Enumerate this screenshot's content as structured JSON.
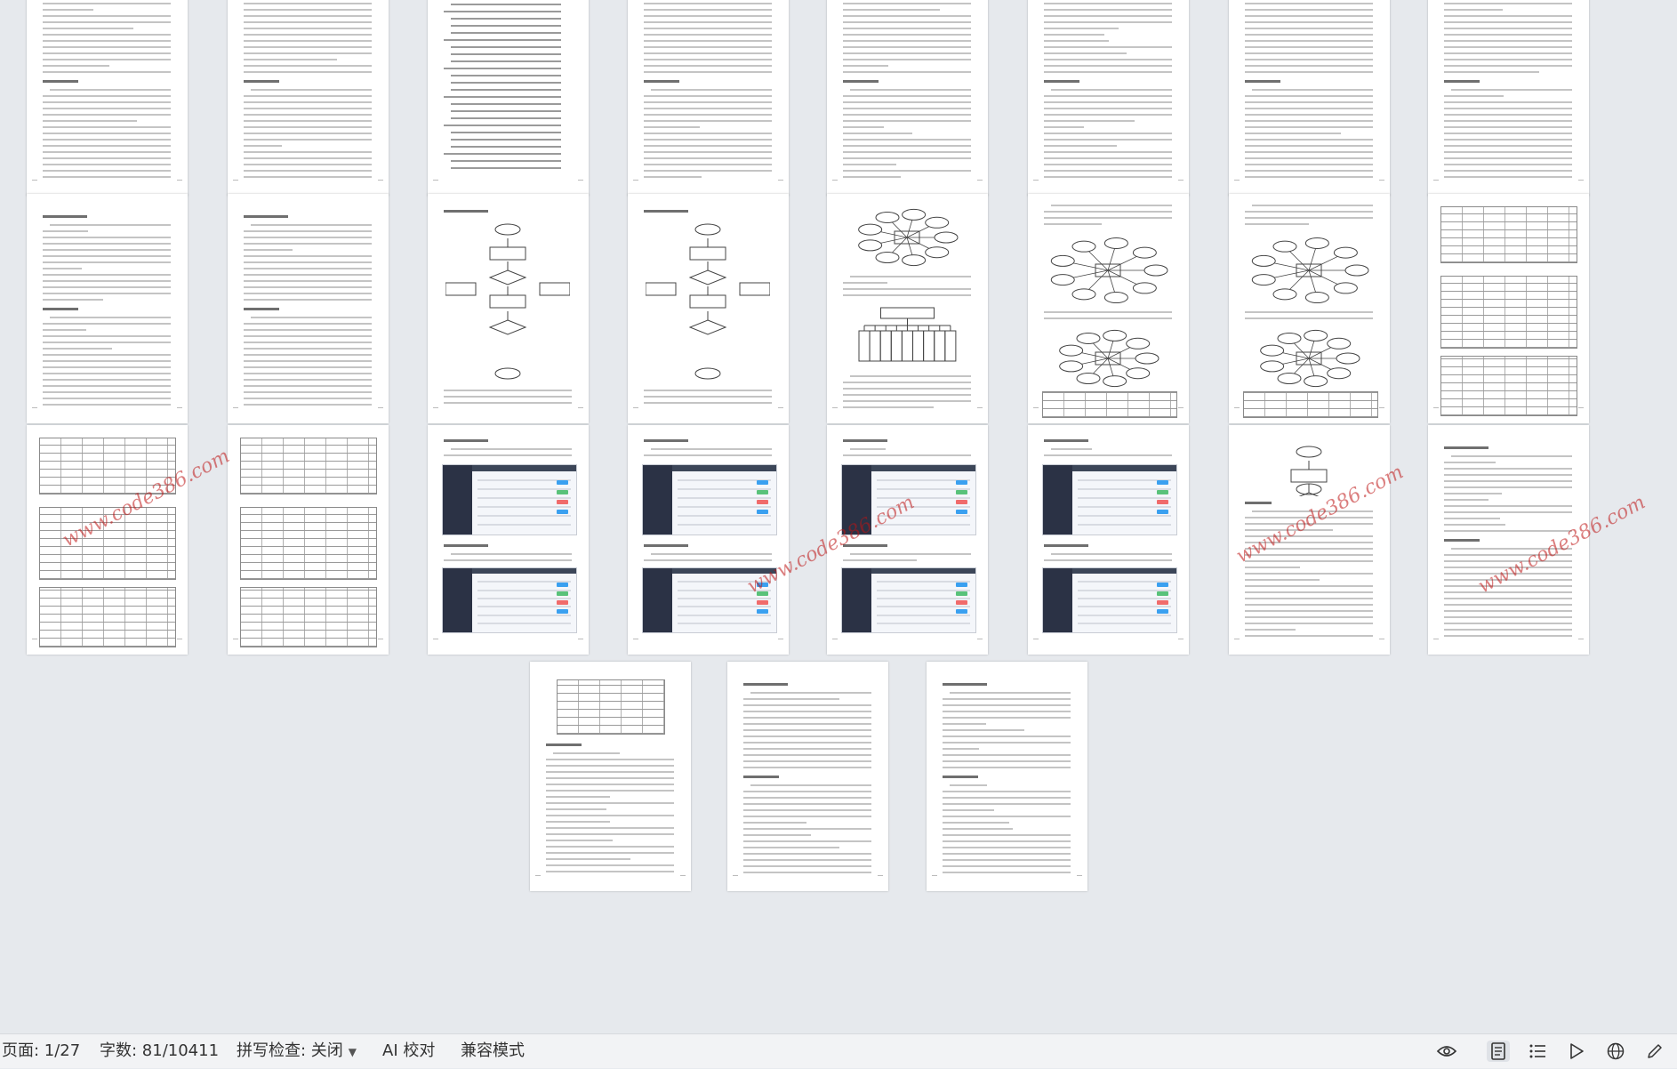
{
  "statusbar": {
    "page_label": "页面: 1/27",
    "word_count_label": "字数: 81/10411",
    "spell_check_label": "拼写检查: 关闭",
    "ai_check_label": "AI 校对",
    "compat_mode_label": "兼容模式"
  },
  "watermark": {
    "text": "www.code386.com"
  },
  "page_text": {
    "chapter_2": "2 相关技术",
    "chapter_4": "4 系统概要设计",
    "chapter_5": "5 系统详细实现",
    "chapter_6": "6 系统测试",
    "conclusion": "结论",
    "acknowledgement": "致谢",
    "references": "参考文献"
  },
  "view_icons": [
    "eye-icon",
    "page-view-icon",
    "outline-icon",
    "play-icon",
    "globe-icon",
    "pen-icon"
  ]
}
